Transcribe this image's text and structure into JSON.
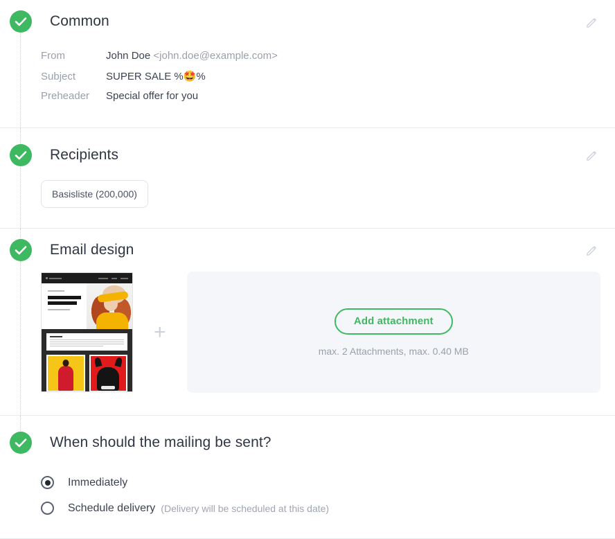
{
  "sections": [
    {
      "id": "common",
      "title": "Common",
      "status_icon": "check-circle-icon",
      "edit_icon": "pencil-icon",
      "fields": [
        {
          "label": "From",
          "value": "John Doe",
          "value_muted": "<john.doe@example.com>"
        },
        {
          "label": "Subject",
          "value": "SUPER SALE %",
          "emoji": "🤩",
          "value_suffix": "%"
        },
        {
          "label": "Preheader",
          "value": "Special offer for you"
        }
      ]
    },
    {
      "id": "recipients",
      "title": "Recipients",
      "status_icon": "check-circle-icon",
      "edit_icon": "pencil-icon",
      "chip": "Basisliste (200,000)"
    },
    {
      "id": "email-design",
      "title": "Email design",
      "status_icon": "check-circle-icon",
      "edit_icon": "pencil-icon",
      "plus_separator": "+",
      "attachment_button": "Add attachment",
      "attachment_hint": "max. 2 Attachments, max. 0.40 MB"
    },
    {
      "id": "schedule",
      "title": "When should the mailing be sent?",
      "status_icon": "check-circle-icon",
      "options": [
        {
          "label": "Immediately",
          "note": "",
          "selected": true
        },
        {
          "label": "Schedule delivery",
          "note": "(Delivery will be scheduled at this date)",
          "selected": false
        }
      ]
    }
  ],
  "colors": {
    "success_green": "#3fb862",
    "accent_green": "#3fb862",
    "text_primary": "#3c4252",
    "text_muted": "#9aa0ac",
    "divider": "#e9ecef",
    "panel_bg": "#f5f6f9"
  }
}
